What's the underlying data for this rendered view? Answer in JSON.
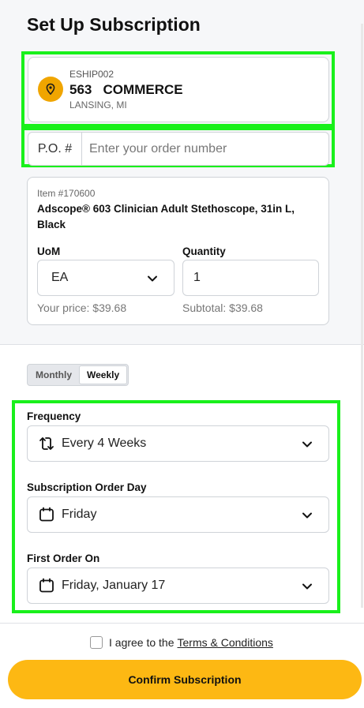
{
  "page": {
    "title": "Set Up Subscription"
  },
  "address": {
    "code": "ESHIP002",
    "name": "563   COMMERCE",
    "city": "LANSING, MI"
  },
  "po": {
    "label": "P.O. #",
    "placeholder": "Enter your order number",
    "value": ""
  },
  "item": {
    "number": "Item #170600",
    "name": "Adscope® 603 Clinician Adult Stethoscope, 31in L, Black",
    "uom_label": "UoM",
    "uom_value": "EA",
    "quantity_label": "Quantity",
    "quantity_value": "1",
    "price": "Your price: $39.68",
    "subtotal": "Subtotal: $39.68"
  },
  "toggle": {
    "monthly": "Monthly",
    "weekly": "Weekly",
    "selected": "weekly"
  },
  "schedule": {
    "frequency_label": "Frequency",
    "frequency_value": "Every 4 Weeks",
    "order_day_label": "Subscription Order Day",
    "order_day_value": "Friday",
    "first_order_label": "First Order On",
    "first_order_value": "Friday, January 17"
  },
  "footer": {
    "agree_text": "I agree to the",
    "terms_link": "Terms & Conditions",
    "confirm_label": "Confirm Subscription"
  },
  "colors": {
    "accent": "#fdb813",
    "highlight": "#19f01b",
    "pin": "#f0a500"
  }
}
